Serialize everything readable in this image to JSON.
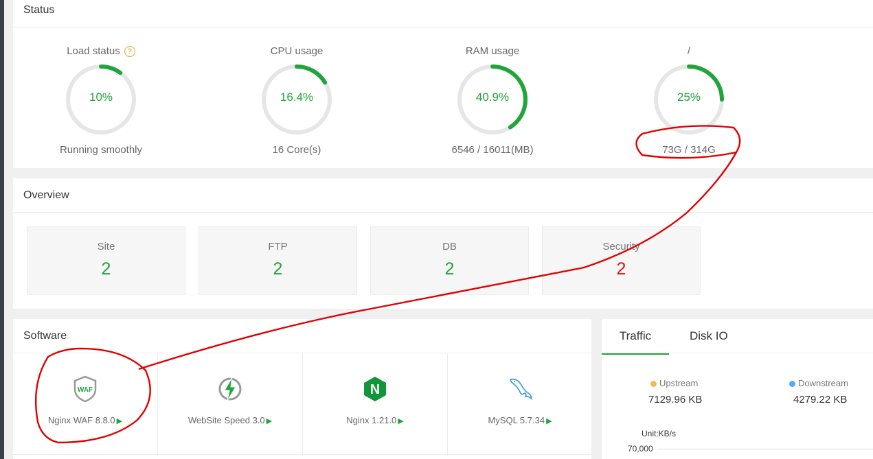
{
  "status": {
    "title": "Status",
    "gauges": [
      {
        "label": "Load status",
        "value": "10%",
        "percent": 10,
        "sub": "Running smoothly",
        "help": "?"
      },
      {
        "label": "CPU usage",
        "value": "16.4%",
        "percent": 16.4,
        "sub": "16 Core(s)"
      },
      {
        "label": "RAM usage",
        "value": "40.9%",
        "percent": 40.9,
        "sub": "6546 / 16011(MB)"
      },
      {
        "label": "/",
        "value": "25%",
        "percent": 25,
        "sub": "73G / 314G"
      }
    ]
  },
  "overview": {
    "title": "Overview",
    "items": [
      {
        "label": "Site",
        "value": "2"
      },
      {
        "label": "FTP",
        "value": "2"
      },
      {
        "label": "DB",
        "value": "2"
      },
      {
        "label": "Security",
        "value": "2"
      }
    ]
  },
  "software": {
    "title": "Software",
    "items": [
      {
        "name": "Nginx WAF 8.8.0",
        "icon": "waf-shield-icon",
        "icon_text": "WAF"
      },
      {
        "name": "WebSite Speed 3.0",
        "icon": "lightning-icon"
      },
      {
        "name": "Nginx 1.21.0",
        "icon": "nginx-icon",
        "icon_text": "N"
      },
      {
        "name": "MySQL 5.7.34",
        "icon": "mysql-dolphin-icon"
      }
    ],
    "play_glyph": "▶"
  },
  "traffic": {
    "tabs": [
      "Traffic",
      "Disk IO"
    ],
    "upstream_label": "Upstream",
    "upstream_value": "7129.96 KB",
    "downstream_label": "Downstream",
    "downstream_value": "4279.22 KB",
    "unit": "Unit:KB/s",
    "y_tick": "70,000"
  },
  "colors": {
    "accent": "#20a53a",
    "danger": "#e01212",
    "upstream": "#f7b851",
    "downstream": "#52a9ff",
    "annotation": "#e00000"
  }
}
